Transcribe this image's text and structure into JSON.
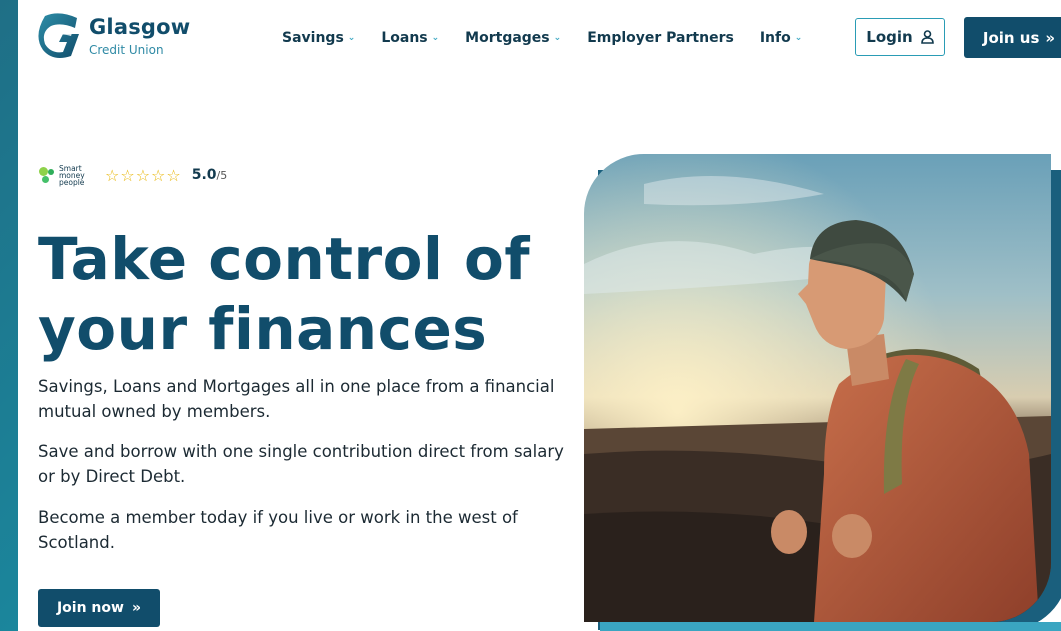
{
  "brand": {
    "name": "Glasgow",
    "subtitle": "Credit Union"
  },
  "nav": {
    "items": [
      {
        "label": "Savings",
        "dropdown": true
      },
      {
        "label": "Loans",
        "dropdown": true
      },
      {
        "label": "Mortgages",
        "dropdown": true
      },
      {
        "label": "Employer Partners",
        "dropdown": false
      },
      {
        "label": "Info",
        "dropdown": true
      }
    ],
    "login_label": "Login",
    "join_label": "Join us"
  },
  "rating": {
    "provider": "Smart money people",
    "stars": 5,
    "score": "5.0",
    "max": "/5"
  },
  "hero": {
    "headline": "Take control of your finances",
    "paragraphs": [
      "Savings, Loans and Mortgages all in one place from a financial mutual owned by members.",
      "Save and borrow with one single contribution direct from salary or by Direct Debt.",
      "Become a member today if you live or work in the west of Scotland."
    ],
    "cta_label": "Join now",
    "image": "young man with beanie and backpack smiling at sunset on moorland"
  },
  "colors": {
    "brand_navy": "#114d6b",
    "accent_teal": "#2a9cb5",
    "star_gold": "#e9b80f"
  }
}
